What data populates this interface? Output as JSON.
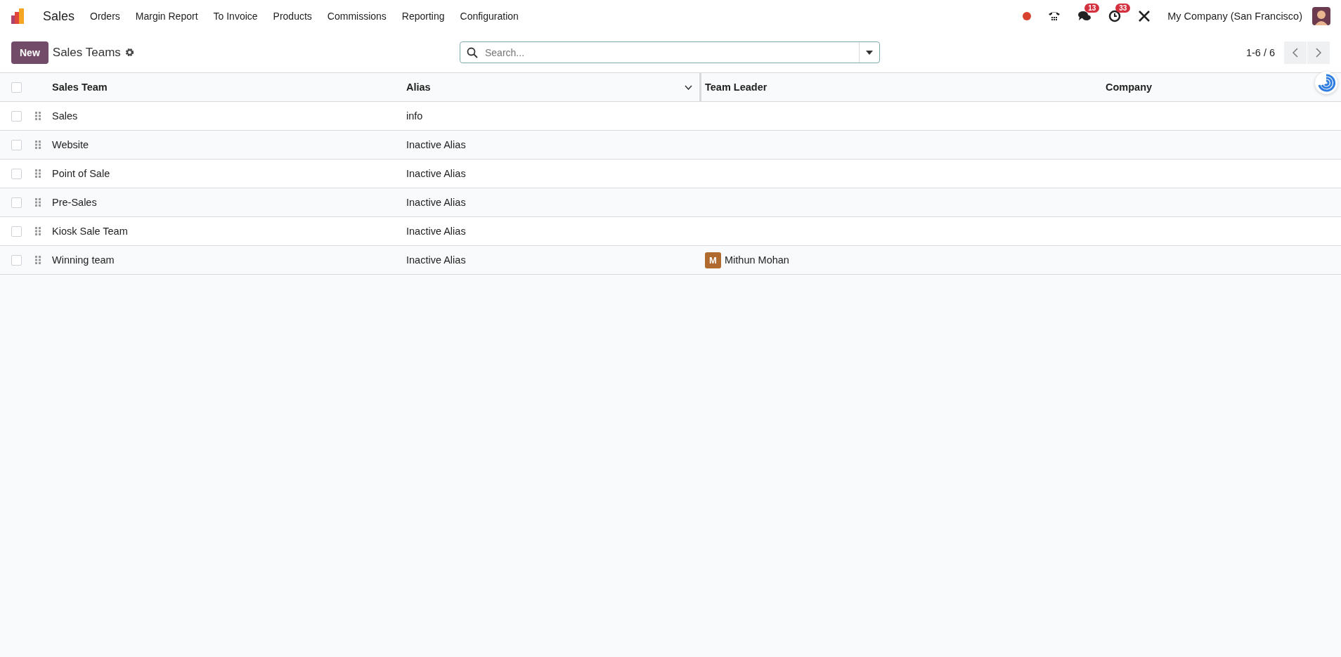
{
  "navbar": {
    "app_name": "Sales",
    "menu": [
      "Orders",
      "Margin Report",
      "To Invoice",
      "Products",
      "Commissions",
      "Reporting",
      "Configuration"
    ],
    "messages_count": "13",
    "activities_count": "33",
    "company": "My Company (San Francisco)"
  },
  "control_panel": {
    "new_button": "New",
    "title": "Sales Teams",
    "search": {
      "placeholder": "Search..."
    },
    "pager": "1-6 / 6"
  },
  "table": {
    "select_all_checked": false,
    "columns": [
      "Sales Team",
      "Alias",
      "Team Leader",
      "Company"
    ],
    "rows": [
      {
        "team": "Sales",
        "alias": "info",
        "selected": false
      },
      {
        "team": "Website",
        "alias": "Inactive Alias",
        "selected": false
      },
      {
        "team": "Point of Sale",
        "alias": "Inactive Alias",
        "selected": false
      },
      {
        "team": "Pre-Sales",
        "alias": "Inactive Alias",
        "selected": false
      },
      {
        "team": "Kiosk Sale Team",
        "alias": "Inactive Alias",
        "selected": false
      },
      {
        "team": "Winning team",
        "alias": "Inactive Alias",
        "selected": false,
        "leader": {
          "initial": "M",
          "name": "Mithun Mohan"
        }
      }
    ]
  }
}
